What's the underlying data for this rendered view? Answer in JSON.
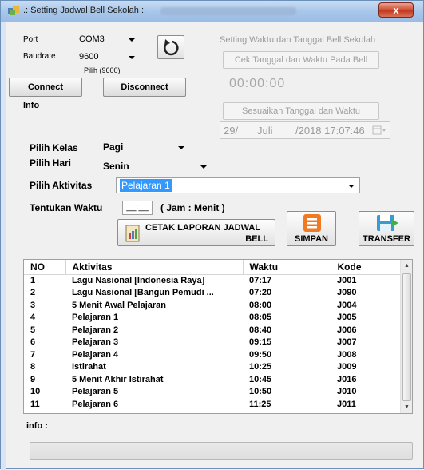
{
  "window": {
    "title": ".: Setting Jadwal Bell Sekolah :.",
    "close_symbol": "x"
  },
  "connection": {
    "port_label": "Port",
    "port_value": "COM3",
    "baudrate_label": "Baudrate",
    "baudrate_value": "9600",
    "hint": "Pilih (9600)",
    "connect_label": "Connect",
    "disconnect_label": "Disconnect",
    "info_label": "Info"
  },
  "bell_settings": {
    "title": "Setting Waktu dan Tanggal  Bell Sekolah",
    "check_button": "Cek Tanggal dan Waktu Pada Bell",
    "time_display": "00:00:00",
    "adjust_button": "Sesuaikan Tanggal dan Waktu",
    "date_day": "29/",
    "date_month": "Juli",
    "date_rest": "/2018 17:07:46"
  },
  "form": {
    "kelas_label": "Pilih Kelas",
    "kelas_value": "Pagi",
    "hari_label": "Pilih Hari",
    "hari_value": "Senin",
    "aktivitas_label": "Pilih Aktivitas",
    "aktivitas_value": "Pelajaran 1",
    "waktu_label": "Tentukan Waktu",
    "waktu_value": "__:__",
    "waktu_hint": "( Jam : Menit )"
  },
  "actions": {
    "print_line1": "CETAK LAPORAN JADWAL",
    "print_line2": "BELL",
    "save_label": "SIMPAN",
    "transfer_label": "TRANSFER"
  },
  "table": {
    "headers": [
      "NO",
      "Aktivitas",
      "Waktu",
      "Kode"
    ],
    "rows": [
      [
        "1",
        "Lagu Nasional [Indonesia Raya]",
        "07:17",
        "J001"
      ],
      [
        "2",
        "Lagu Nasional [Bangun Pemudi ...",
        "07:20",
        "J090"
      ],
      [
        "3",
        "5 Menit Awal Pelajaran",
        "08:00",
        "J004"
      ],
      [
        "4",
        "Pelajaran 1",
        "08:05",
        "J005"
      ],
      [
        "5",
        "Pelajaran 2",
        "08:40",
        "J006"
      ],
      [
        "6",
        "Pelajaran 3",
        "09:15",
        "J007"
      ],
      [
        "7",
        "Pelajaran 4",
        "09:50",
        "J008"
      ],
      [
        "8",
        "Istirahat",
        "10:25",
        "J009"
      ],
      [
        "9",
        "5 Menit Akhir Istirahat",
        "10:45",
        "J016"
      ],
      [
        "10",
        "Pelajaran 5",
        "10:50",
        "J010"
      ],
      [
        "11",
        "Pelajaran 6",
        "11:25",
        "J011"
      ]
    ]
  },
  "footer": {
    "info_label": "info :"
  }
}
